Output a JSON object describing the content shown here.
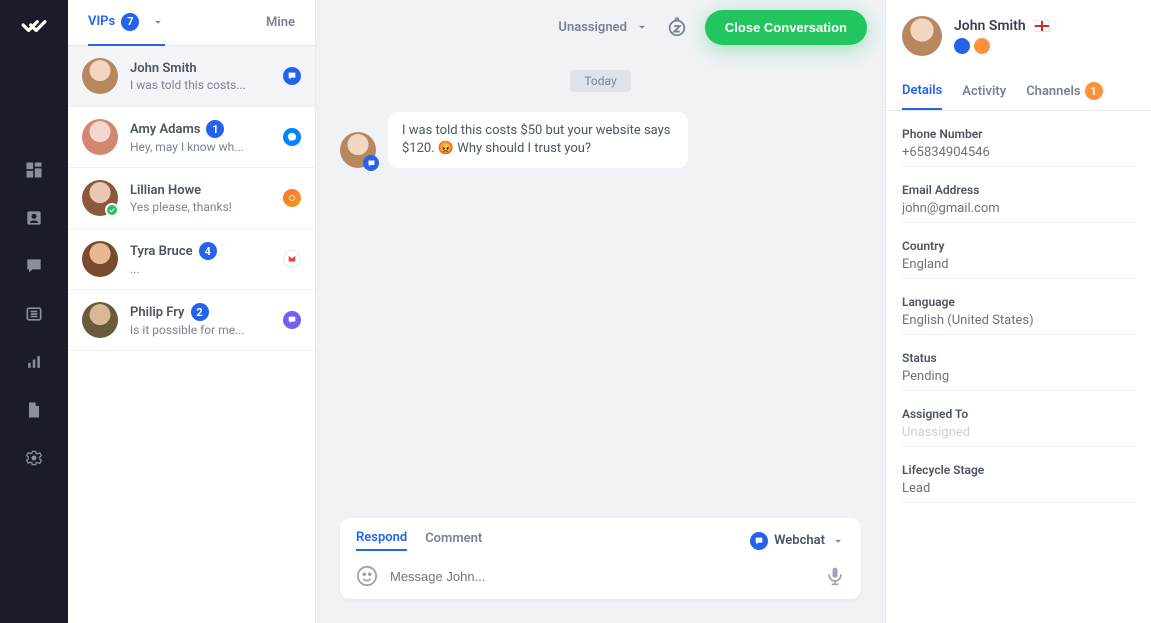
{
  "tabs": {
    "vips": "VIPs",
    "vips_count": "7",
    "mine": "Mine"
  },
  "conversations": [
    {
      "name": "John Smith",
      "preview": "I was told this costs...",
      "channel": "webchat",
      "selected": true
    },
    {
      "name": "Amy Adams",
      "preview": "Hey, may I know wh...",
      "badge": "1",
      "channel": "messenger"
    },
    {
      "name": "Lillian Howe",
      "preview": "Yes please, thanks!",
      "channel": "swirl",
      "verified": true
    },
    {
      "name": "Tyra Bruce",
      "preview": "...",
      "badge": "4",
      "channel": "gmail"
    },
    {
      "name": "Philip Fry",
      "preview": "Is it possible for me...",
      "badge": "2",
      "channel": "viber"
    }
  ],
  "header": {
    "unassigned": "Unassigned",
    "close": "Close Conversation"
  },
  "date_chip": "Today",
  "message": "I was told this costs $50 but your website says $120. 😡 Why should I trust you?",
  "composer": {
    "respond": "Respond",
    "comment": "Comment",
    "webchat": "Webchat",
    "placeholder": "Message John..."
  },
  "contact": {
    "name": "John Smith",
    "tabs": {
      "details": "Details",
      "activity": "Activity",
      "channels": "Channels",
      "channels_badge": "1"
    },
    "fields": {
      "phone_label": "Phone Number",
      "phone": "+65834904546",
      "email_label": "Email Address",
      "email": "john@gmail.com",
      "country_label": "Country",
      "country": "England",
      "language_label": "Language",
      "language": "English (United States)",
      "status_label": "Status",
      "status": "Pending",
      "assigned_label": "Assigned To",
      "assigned": "Unassigned",
      "lifecycle_label": "Lifecycle Stage",
      "lifecycle": "Lead"
    }
  }
}
